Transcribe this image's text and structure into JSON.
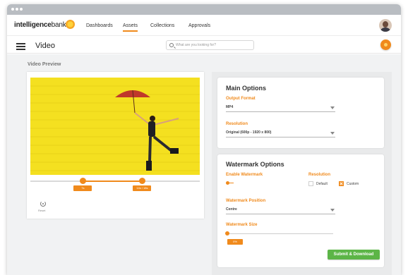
{
  "nav": {
    "brand_bold": "intelligence",
    "brand_light": "bank",
    "items": [
      "Dashboards",
      "Assets",
      "Collections",
      "Approvals"
    ],
    "active": "Assets"
  },
  "subbar": {
    "title": "Video",
    "search_placeholder": "What are you looking for?"
  },
  "preview": {
    "section_label": "Video Preview",
    "trim_start_label": "7s",
    "trim_end_label": "14s / 18s",
    "trim_start_fraction": 0.31,
    "trim_end_fraction": 0.66,
    "reset_label": "Reset"
  },
  "main_options": {
    "title": "Main Options",
    "output_format_label": "Output Format",
    "output_format_value": "MP4",
    "resolution_label": "Resolution",
    "resolution_value": "Original (600p - 1920 x 800)"
  },
  "watermark": {
    "title": "Watermark Options",
    "enable_label": "Enable Watermark",
    "enable_state": "on",
    "resolution_label": "Resolution",
    "option_default": "Default",
    "option_custom": "Custom",
    "selected_option": "Custom",
    "position_label": "Watermark Position",
    "position_value": "Centre",
    "size_label": "Watermark Size",
    "size_value": "0%",
    "size_fraction": 0
  },
  "actions": {
    "submit_label": "Submit & Download"
  },
  "colors": {
    "accent": "#f08a1c",
    "submit": "#5cb547",
    "video_background": "#f4e020"
  },
  "icons": {
    "menu": "hamburger-icon",
    "search": "search-icon",
    "reset": "reset-icon",
    "chevron": "chevron-down-icon"
  }
}
